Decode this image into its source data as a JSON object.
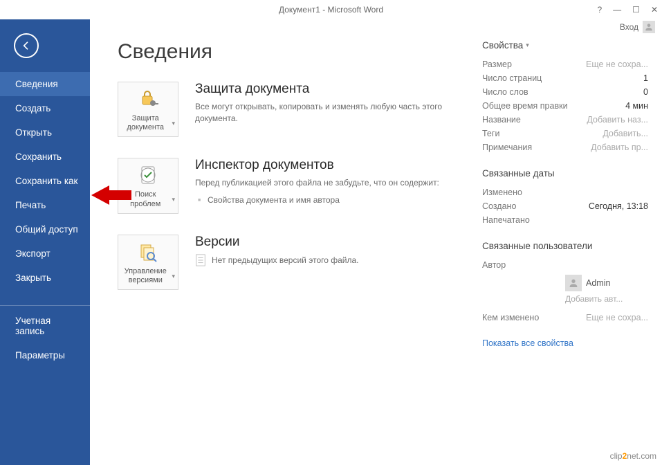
{
  "titlebar": {
    "title": "Документ1 - Microsoft Word",
    "help": "?",
    "signin": "Вход"
  },
  "sidebar": {
    "items": [
      {
        "label": "Сведения",
        "active": true
      },
      {
        "label": "Создать"
      },
      {
        "label": "Открыть"
      },
      {
        "label": "Сохранить"
      },
      {
        "label": "Сохранить как"
      },
      {
        "label": "Печать"
      },
      {
        "label": "Общий доступ"
      },
      {
        "label": "Экспорт"
      },
      {
        "label": "Закрыть"
      }
    ],
    "footer": [
      {
        "label": "Учетная запись"
      },
      {
        "label": "Параметры"
      }
    ]
  },
  "page": {
    "title": "Сведения"
  },
  "protect": {
    "btn": "Защита документа",
    "heading": "Защита документа",
    "desc": "Все могут открывать, копировать и изменять любую часть этого документа."
  },
  "inspect": {
    "btn": "Поиск проблем",
    "heading": "Инспектор документов",
    "desc": "Перед публикацией этого файла не забудьте, что он содержит:",
    "item1": "Свойства документа и имя автора"
  },
  "versions": {
    "btn": "Управление версиями",
    "heading": "Версии",
    "none": "Нет предыдущих версий этого файла."
  },
  "props": {
    "heading": "Свойства",
    "rows": {
      "size_k": "Размер",
      "size_v": "Еще не сохра...",
      "pages_k": "Число страниц",
      "pages_v": "1",
      "words_k": "Число слов",
      "words_v": "0",
      "edit_k": "Общее время правки",
      "edit_v": "4 мин",
      "title_k": "Название",
      "title_v": "Добавить наз...",
      "tags_k": "Теги",
      "tags_v": "Добавить...",
      "notes_k": "Примечания",
      "notes_v": "Добавить пр..."
    }
  },
  "dates": {
    "heading": "Связанные даты",
    "mod_k": "Изменено",
    "mod_v": "",
    "created_k": "Создано",
    "created_v": "Сегодня, 13:18",
    "printed_k": "Напечатано",
    "printed_v": ""
  },
  "users": {
    "heading": "Связанные пользователи",
    "author_k": "Автор",
    "author_v": "Admin",
    "add_author": "Добавить авт...",
    "changed_k": "Кем изменено",
    "changed_v": "Еще не сохра..."
  },
  "showall": "Показать все свойства",
  "watermark": {
    "pre": "clip",
    "mid": "2",
    "post": "net",
    "suffix": ".com"
  }
}
